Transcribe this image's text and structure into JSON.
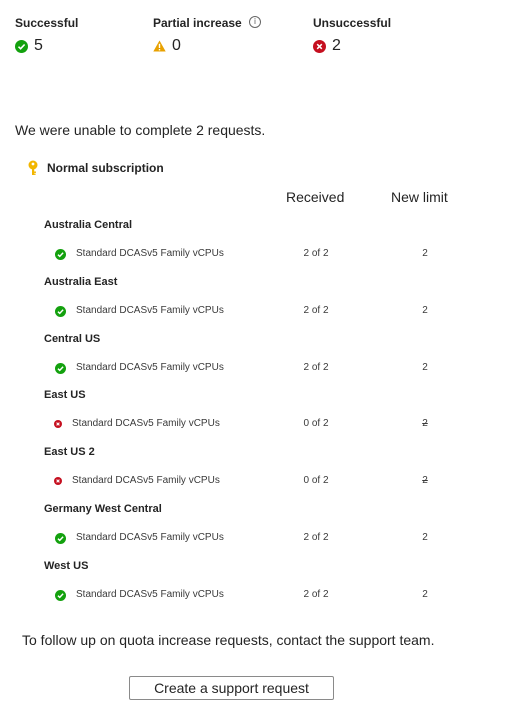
{
  "summary": {
    "successful": {
      "label": "Successful",
      "count": "5",
      "icon": "check-circle-icon",
      "color": "#13a10e"
    },
    "partial": {
      "label": "Partial increase",
      "count": "0",
      "icon": "warning-icon",
      "color": "#e8a100"
    },
    "unsuccessful": {
      "label": "Unsuccessful",
      "count": "2",
      "icon": "error-circle-icon",
      "color": "#c50f1f"
    }
  },
  "message": "We were unable to complete 2 requests.",
  "subscription": {
    "name": "Normal subscription",
    "icon": "key-icon"
  },
  "columns": {
    "received": "Received",
    "new_limit": "New limit"
  },
  "regions": [
    {
      "name": "Australia Central",
      "items": [
        {
          "status": "success",
          "resource": "Standard DCASv5 Family vCPUs",
          "received": "2 of 2",
          "new_limit": "2"
        }
      ]
    },
    {
      "name": "Australia East",
      "items": [
        {
          "status": "success",
          "resource": "Standard DCASv5 Family vCPUs",
          "received": "2 of 2",
          "new_limit": "2"
        }
      ]
    },
    {
      "name": "Central US",
      "items": [
        {
          "status": "success",
          "resource": "Standard DCASv5 Family vCPUs",
          "received": "2 of 2",
          "new_limit": "2"
        }
      ]
    },
    {
      "name": "East US",
      "items": [
        {
          "status": "error",
          "resource": "Standard DCASv5 Family vCPUs",
          "received": "0 of 2",
          "new_limit": "2"
        }
      ]
    },
    {
      "name": "East US 2",
      "items": [
        {
          "status": "error",
          "resource": "Standard DCASv5 Family vCPUs",
          "received": "0 of 2",
          "new_limit": "2"
        }
      ]
    },
    {
      "name": "Germany West Central",
      "items": [
        {
          "status": "success",
          "resource": "Standard DCASv5 Family vCPUs",
          "received": "2 of 2",
          "new_limit": "2"
        }
      ]
    },
    {
      "name": "West US",
      "items": [
        {
          "status": "success",
          "resource": "Standard DCASv5 Family vCPUs",
          "received": "2 of 2",
          "new_limit": "2"
        }
      ]
    }
  ],
  "footer": {
    "text": "To follow up on quota increase requests, contact the support team.",
    "button_label": "Create a support request"
  }
}
